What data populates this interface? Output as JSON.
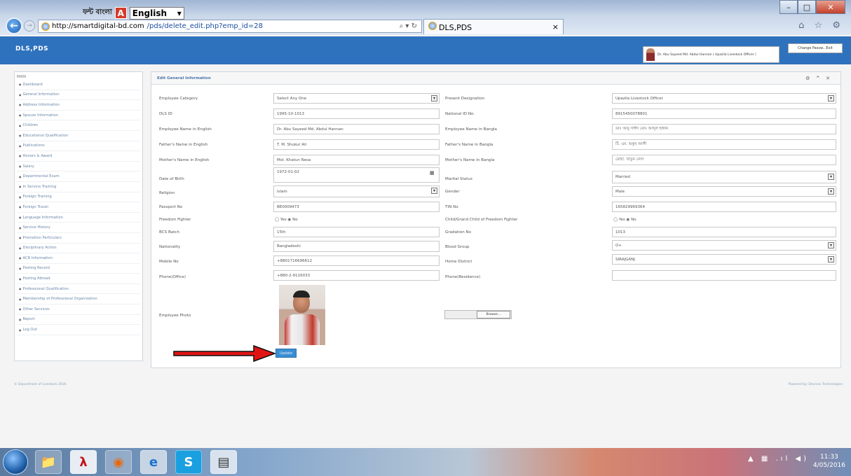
{
  "browser": {
    "ime_bangla": "ফন্ট বাংলা",
    "ime_language": "English",
    "url_host": "http://smartdigital-bd.com",
    "url_path": "/pds/delete_edit.php?emp_id=28",
    "address_controls": "⌕ ▾ ↻",
    "tab_title": "DLS,PDS",
    "tab_close": "×",
    "toolbar_icons": "⌂ ☆ ⚙",
    "win_min": "–",
    "win_max": "□",
    "win_close": "✕"
  },
  "app": {
    "brand": "DLS,PDS",
    "user_label": "Dr. Abu Sayeed Md. Abdul Hannan ( Upazila Livestock Officer )",
    "change_password": "Change Passw...Exit"
  },
  "sidebar": {
    "heading": "MAIN",
    "items": [
      {
        "label": "Dashboard"
      },
      {
        "label": "General Information"
      },
      {
        "label": "Address Information"
      },
      {
        "label": "Spouse Information"
      },
      {
        "label": "Children"
      },
      {
        "label": "Educational Qualification"
      },
      {
        "label": "Publications"
      },
      {
        "label": "Honors & Award"
      },
      {
        "label": "Salary"
      },
      {
        "label": "Departmental Exam"
      },
      {
        "label": "In Service Training"
      },
      {
        "label": "Foreign Training"
      },
      {
        "label": "Foreign Travel"
      },
      {
        "label": "Language Information"
      },
      {
        "label": "Service History"
      },
      {
        "label": "Promotion Particulars"
      },
      {
        "label": "Disciplinary Action"
      },
      {
        "label": "ACR Information"
      },
      {
        "label": "Posting Record"
      },
      {
        "label": "Posting Abroad"
      },
      {
        "label": "Professional Qualification"
      },
      {
        "label": "Membership of Professional Organization"
      },
      {
        "label": "Other Services"
      },
      {
        "label": "Report"
      },
      {
        "label": "Log Out"
      }
    ]
  },
  "panel": {
    "title": "Edit General Information",
    "controls": "⚙ ^ ✕"
  },
  "form": {
    "employee_category_label": "Employee Category",
    "employee_category_value": "Select Any One",
    "present_designation_label": "Present Designation",
    "present_designation_value": "Upazila Livestock Officer",
    "dls_id_label": "DLS ID",
    "dls_id_value": "1995-10-1013",
    "national_id_label": "National ID No.",
    "national_id_value": "8915450078801",
    "name_en_label": "Employee Name in English",
    "name_en_value": "Dr. Abu Sayeed Md. Abdul Hannan",
    "name_bn_label": "Employee Name in Bangla",
    "name_bn_value": "ডাঃ আবু সাঈদ মোঃ আব্দুল হান্নান",
    "father_en_label": "Father's Name in English",
    "father_en_value": "T. M. Shukur Ali",
    "father_bn_label": "Father's Name in Bangla",
    "father_bn_value": "টি. এম. শুকুর আলী",
    "mother_en_label": "Mother's Name in English",
    "mother_en_value": "Mst. Khatun Nesa",
    "mother_bn_label": "Mother's Name in Bangla",
    "mother_bn_value": "মোছা. খাতুন নেসা",
    "dob_label": "Date of Birth",
    "dob_value": "1972-01-02",
    "marital_label": "Marital Status",
    "marital_value": "Married",
    "religion_label": "Religion",
    "religion_value": "Islam",
    "gender_label": "Gender",
    "gender_value": "Male",
    "passport_label": "Passport No",
    "passport_value": "BE0009473",
    "tin_label": "TIN No",
    "tin_value": "165829969364",
    "freedom_fighter_label": "Freedom Fighter",
    "freedom_fighter_radios": "◯ Yes ◉ No",
    "ff_child_label": "Child/Grand Child of Freedom Fighter",
    "ff_child_radios": "◯ Yes ◉ No",
    "bcs_batch_label": "BCS Batch",
    "bcs_batch_value": "15th",
    "gradation_label": "Gradation No",
    "gradation_value": "1013",
    "nationality_label": "Nationality",
    "nationality_value": "Bangladeshi",
    "blood_label": "Blood Group",
    "blood_value": "O+",
    "mobile_label": "Mobile No",
    "mobile_value": "+8801716696612",
    "home_district_label": "Home District",
    "home_district_value": "SIRAJGANJ",
    "phone_office_label": "Phone(Office)",
    "phone_office_value": "+880-2-9116033",
    "phone_res_label": "Phone(Residence)",
    "phone_res_value": "",
    "photo_label": "Employee Photo",
    "browse_label": "Browse...",
    "update_label": "Update",
    "select_arrow": "▾",
    "calendar_icon": "▦"
  },
  "footer": {
    "left": "© Department of Livestock 2016",
    "right": "Powered by: Devicon Technologies"
  },
  "taskbar": {
    "tray": "▲ ▦ .ıl ◀)",
    "time": "11:33",
    "date": "4/05/2016",
    "apps": [
      {
        "glyph": "📁"
      },
      {
        "glyph": "λ"
      },
      {
        "glyph": "◉"
      },
      {
        "glyph": "e"
      },
      {
        "glyph": "S"
      },
      {
        "glyph": "▤"
      }
    ]
  }
}
